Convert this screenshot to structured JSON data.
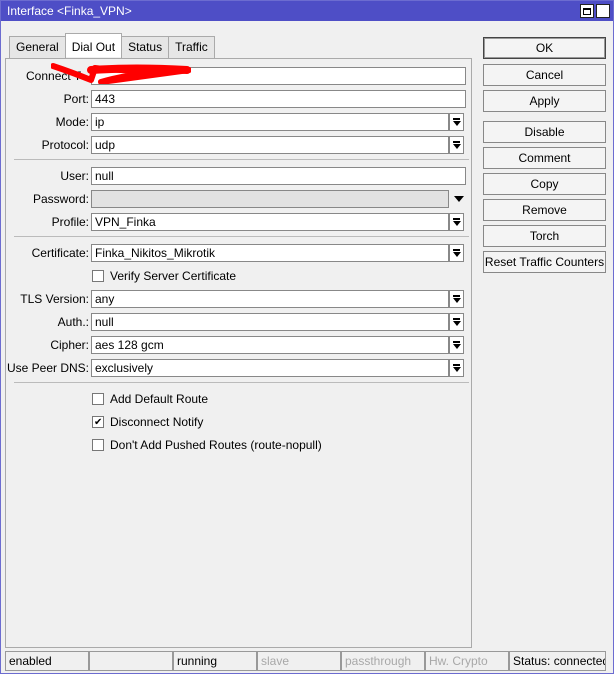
{
  "window": {
    "title": "Interface <Finka_VPN>"
  },
  "tabs": [
    {
      "label": "General"
    },
    {
      "label": "Dial Out"
    },
    {
      "label": "Status"
    },
    {
      "label": "Traffic"
    }
  ],
  "form": {
    "connect_to": {
      "label": "Connect T",
      "value": ""
    },
    "port": {
      "label": "Port:",
      "value": "443"
    },
    "mode": {
      "label": "Mode:",
      "value": "ip"
    },
    "protocol": {
      "label": "Protocol:",
      "value": "udp"
    },
    "user": {
      "label": "User:",
      "value": "null"
    },
    "password": {
      "label": "Password:",
      "value": ""
    },
    "profile": {
      "label": "Profile:",
      "value": "VPN_Finka"
    },
    "certificate": {
      "label": "Certificate:",
      "value": "Finka_Nikitos_Mikrotik"
    },
    "verify_server_certificate": {
      "label": "Verify Server Certificate",
      "checked": false
    },
    "tls_version": {
      "label": "TLS Version:",
      "value": "any"
    },
    "auth": {
      "label": "Auth.:",
      "value": "null"
    },
    "cipher": {
      "label": "Cipher:",
      "value": "aes 128 gcm"
    },
    "use_peer_dns": {
      "label": "Use Peer DNS:",
      "value": "exclusively"
    },
    "add_default_route": {
      "label": "Add Default Route",
      "checked": false
    },
    "disconnect_notify": {
      "label": "Disconnect Notify",
      "checked": true
    },
    "dont_add_pushed_routes": {
      "label": "Don't Add Pushed Routes (route-nopull)",
      "checked": false
    }
  },
  "buttons": {
    "ok": "OK",
    "cancel": "Cancel",
    "apply": "Apply",
    "disable": "Disable",
    "comment": "Comment",
    "copy": "Copy",
    "remove": "Remove",
    "torch": "Torch",
    "reset_traffic_counters": "Reset Traffic Counters"
  },
  "statusbar": {
    "state": "enabled",
    "blank": "",
    "running": "running",
    "slave": "slave",
    "passthrough": "passthrough",
    "hw_crypto": "Hw. Crypto",
    "status": "Status: connected"
  },
  "colors": {
    "titlebar": "#4e4ec6",
    "redaction": "#ff0000"
  }
}
